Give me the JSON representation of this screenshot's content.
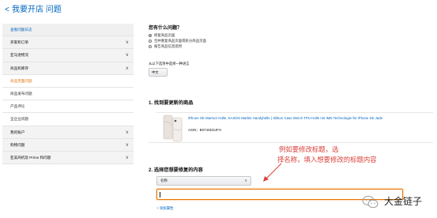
{
  "header": {
    "back_chevron": "<",
    "title": "我要开店 问题"
  },
  "sidebar": {
    "items": [
      {
        "label": "查看问题日志",
        "type": "head",
        "chevron": ""
      },
      {
        "label": "买家和订单",
        "type": "group",
        "chevron": "∨"
      },
      {
        "label": "亚马逊物流",
        "type": "group",
        "chevron": "∨"
      },
      {
        "label": "商品和库存",
        "type": "group",
        "chevron": "∧"
      },
      {
        "label": "商品页面问题",
        "type": "active",
        "chevron": ""
      },
      {
        "label": "商品发布问题",
        "type": "sub",
        "chevron": ""
      },
      {
        "label": "产品评论",
        "type": "sub",
        "chevron": ""
      },
      {
        "label": "全企业问题",
        "type": "sub",
        "chevron": ""
      },
      {
        "label": "我的账户",
        "type": "group",
        "chevron": "∨"
      },
      {
        "label": "购物问题",
        "type": "group",
        "chevron": "∨"
      },
      {
        "label": "亚美商机及 Prime 和问题",
        "type": "group",
        "chevron": "∨"
      }
    ]
  },
  "question": {
    "title": "您有什么问题？",
    "options": [
      {
        "label": "修复商品页面",
        "selected": true
      },
      {
        "label": "合并重复商品页面或拆分商品页面",
        "selected": false
      },
      {
        "label": "报告商品信息滥用",
        "selected": false
      }
    ]
  },
  "language": {
    "label": "从以下选项中选择一种语言",
    "value": "中文"
  },
  "section1": {
    "title": "1. 找到要更新的商品",
    "product": {
      "name": "iPhone SE Marmor Hülle, KASOS Marble Handyhülle | Silikon Case Weich TPU Hülle mit IMD Technologie für iPhone SE Jade",
      "asin": "ASIN：B074SDSJFH"
    }
  },
  "section2": {
    "title": "2. 选择您想要修复的内容",
    "field_value": "名称",
    "field_chevron": "∨",
    "input_value": "",
    "add_attribute": "+ 添加属性"
  },
  "annotation": {
    "line1": "例如要修改标题，选",
    "line2": "择名称，填入想要修改的标题内容",
    "color": "#d9413a"
  },
  "watermark": {
    "text": "大金链子"
  },
  "colors": {
    "link": "#0066c0",
    "active": "#e47911",
    "input_focus": "#e77600"
  }
}
